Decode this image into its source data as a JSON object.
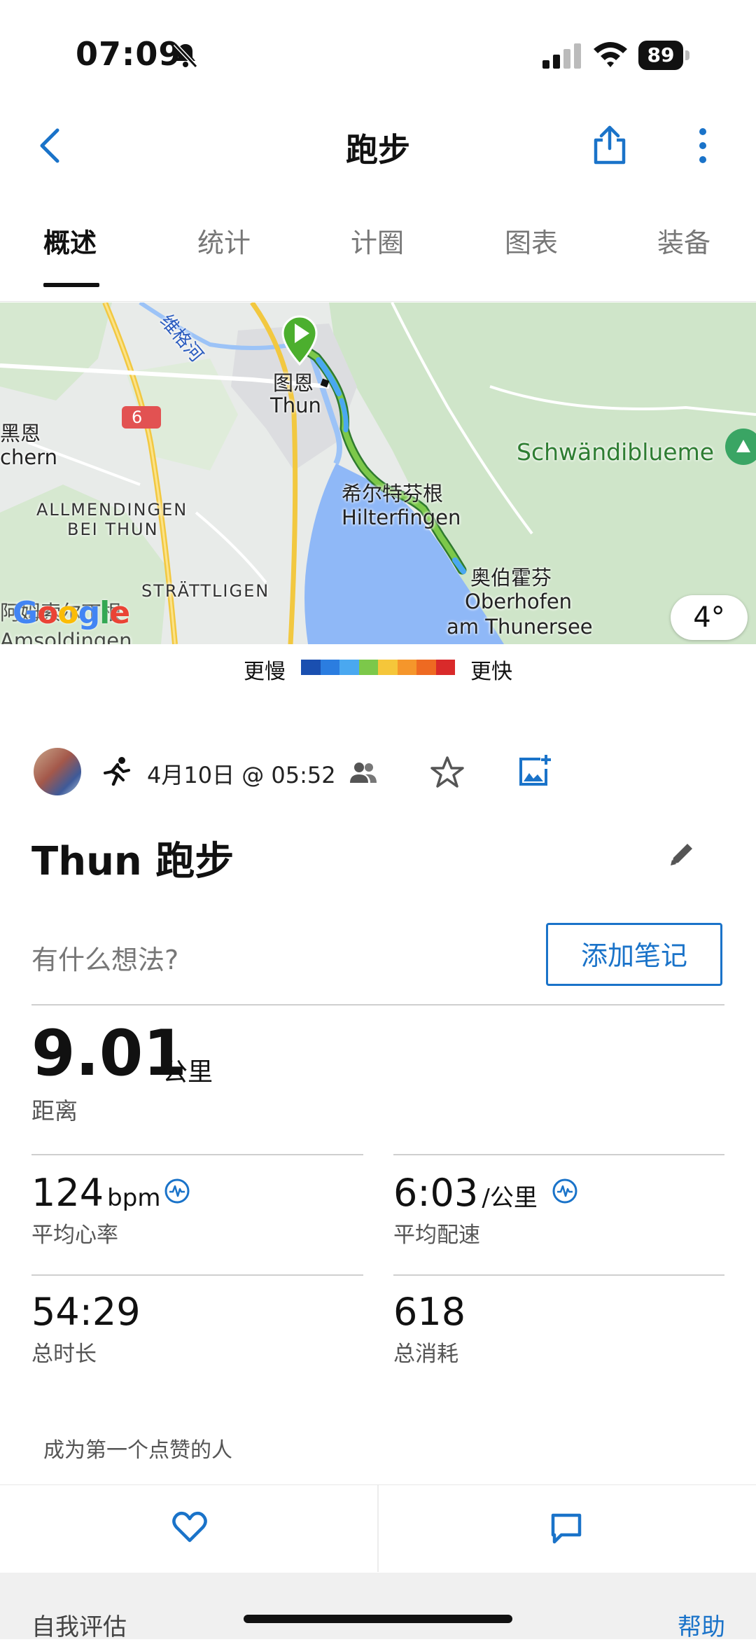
{
  "status_bar": {
    "time": "07:09",
    "battery": "89",
    "icons": [
      "bell-slash-icon",
      "signal-icon",
      "wifi-icon",
      "battery-icon"
    ]
  },
  "header": {
    "title": "跑步",
    "icons": [
      "chevron-left-icon",
      "share-icon",
      "more-vertical-icon"
    ]
  },
  "tabs": [
    "概述",
    "统计",
    "计圈",
    "图表",
    "装备"
  ],
  "active_tab": "概述",
  "map": {
    "labels": {
      "river": "维格河",
      "road_number": "6",
      "thun_cn": "图恩",
      "thun": "Thun",
      "schwarzenegg_cn": "黑恩",
      "schwarzenegg": "chern",
      "allmendingen_1": "ALLMENDINGEN",
      "allmendingen_2": "BEI THUN",
      "strattligen": "STRÄTTLIGEN",
      "hilterfingen_cn": "希尔特芬根",
      "hilterfingen": "Hilterfingen",
      "oberhofen_cn": "奥伯霍芬",
      "oberhofen_1": "Oberhofen",
      "oberhofen_2": "am Thunersee",
      "schwandibluem": "Schwändiblueme",
      "amsoldingen_cn": "阿姆索尔丁根",
      "amsoldingen": "Amsoldingen",
      "google": "Google"
    },
    "temperature": "4°"
  },
  "legend": {
    "slower": "更慢",
    "faster": "更快",
    "colors": [
      "#1a4fb0",
      "#2b7de0",
      "#4aa8f0",
      "#7cc84a",
      "#f5c63a",
      "#f5962b",
      "#ee6a22",
      "#d92a2a"
    ]
  },
  "activity": {
    "date": "4月10日 @ 05:52",
    "title": "Thun 跑步",
    "thoughts_placeholder": "有什么想法?",
    "add_note": "添加笔记"
  },
  "stats": {
    "distance": {
      "value": "9.01",
      "unit": "公里",
      "label": "距离"
    },
    "avg_hr": {
      "value": "124",
      "unit": "bpm",
      "label": "平均心率"
    },
    "avg_pace": {
      "value": "6:03",
      "unit": "/公里",
      "label": "平均配速"
    },
    "total_time": {
      "value": "54:29",
      "label": "总时长"
    },
    "total_cal": {
      "value": "618",
      "label": "总消耗"
    }
  },
  "social": {
    "first_like": "成为第一个点赞的人"
  },
  "footer": {
    "self_eval": "自我评估",
    "help": "帮助"
  },
  "colors": {
    "accent": "#1a73c9",
    "lake": "#8fb8f7",
    "forest": "#cfe5c9"
  }
}
